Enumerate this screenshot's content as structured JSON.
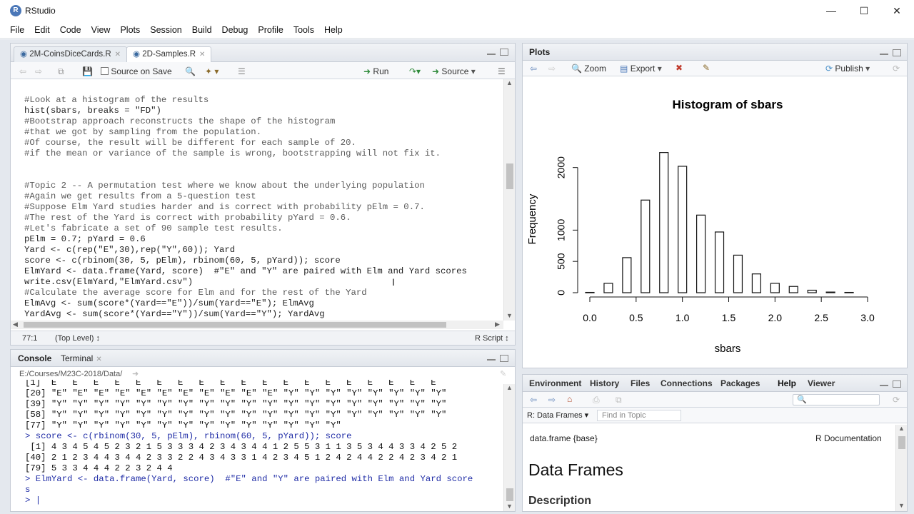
{
  "window": {
    "title": "RStudio",
    "logo": "R"
  },
  "menu": [
    "File",
    "Edit",
    "Code",
    "View",
    "Plots",
    "Session",
    "Build",
    "Debug",
    "Profile",
    "Tools",
    "Help"
  ],
  "editor": {
    "tabs": [
      "2M-CoinsDiceCards.R",
      "2D-Samples.R"
    ],
    "source_on_save": "Source on Save",
    "run": "Run",
    "source": "Source",
    "lines": [
      {
        "text": "#Look at a histogram of the results",
        "kind": "cmt"
      },
      {
        "text": "hist(sbars, breaks = \"FD\")",
        "kind": "code"
      },
      {
        "text": "#Bootstrap approach reconstructs the shape of the histogram",
        "kind": "cmt"
      },
      {
        "text": "#that we got by sampling from the population.",
        "kind": "cmt"
      },
      {
        "text": "#Of course, the result will be different for each sample of 20.",
        "kind": "cmt"
      },
      {
        "text": "#if the mean or variance of the sample is wrong, bootstrapping will not fix it.",
        "kind": "cmt"
      },
      {
        "text": "",
        "kind": "code"
      },
      {
        "text": "",
        "kind": "code"
      },
      {
        "text": "#Topic 2 -- A permutation test where we know about the underlying population",
        "kind": "cmt"
      },
      {
        "text": "#Again we get results from a 5-question test",
        "kind": "cmt"
      },
      {
        "text": "#Suppose Elm Yard studies harder and is correct with probability pElm = 0.7.",
        "kind": "cmt"
      },
      {
        "text": "#The rest of the Yard is correct with probability pYard = 0.6.",
        "kind": "cmt"
      },
      {
        "text": "#Let's fabricate a set of 90 sample test results.",
        "kind": "cmt"
      },
      {
        "text": "pElm = 0.7; pYard = 0.6",
        "kind": "code"
      },
      {
        "text": "Yard <- c(rep(\"E\",30),rep(\"Y\",60)); Yard",
        "kind": "code"
      },
      {
        "text": "score <- c(rbinom(30, 5, pElm), rbinom(60, 5, pYard)); score",
        "kind": "code"
      },
      {
        "text": "ElmYard <- data.frame(Yard, score)  #\"E\" and \"Y\" are paired with Elm and Yard scores",
        "kind": "code"
      },
      {
        "text": "write.csv(ElmYard,\"ElmYard.csv\")",
        "kind": "code"
      },
      {
        "text": "#Calculate the average score for Elm and for the rest of the Yard",
        "kind": "cmt"
      },
      {
        "text": "ElmAvg <- sum(score*(Yard==\"E\"))/sum(Yard==\"E\"); ElmAvg",
        "kind": "code"
      },
      {
        "text": "YardAvg <- sum(score*(Yard==\"Y\"))/sum(Yard==\"Y\"); YardAvg",
        "kind": "code"
      }
    ],
    "status_pos": "77:1",
    "status_scope": "(Top Level) ↕",
    "status_type": "R Script ↕"
  },
  "console": {
    "tabs": [
      "Console",
      "Terminal"
    ],
    "path": "E:/Courses/M23C-2018/Data/",
    "lines": [
      {
        "text": "[1]  E   E   E   E   E   E   E   E   E   E   E   E   E   E   E   E   E   E   E",
        "kind": "out"
      },
      {
        "text": "[20] \"E\" \"E\" \"E\" \"E\" \"E\" \"E\" \"E\" \"E\" \"E\" \"E\" \"E\" \"Y\" \"Y\" \"Y\" \"Y\" \"Y\" \"Y\" \"Y\" \"Y\"",
        "kind": "out"
      },
      {
        "text": "[39] \"Y\" \"Y\" \"Y\" \"Y\" \"Y\" \"Y\" \"Y\" \"Y\" \"Y\" \"Y\" \"Y\" \"Y\" \"Y\" \"Y\" \"Y\" \"Y\" \"Y\" \"Y\" \"Y\"",
        "kind": "out"
      },
      {
        "text": "[58] \"Y\" \"Y\" \"Y\" \"Y\" \"Y\" \"Y\" \"Y\" \"Y\" \"Y\" \"Y\" \"Y\" \"Y\" \"Y\" \"Y\" \"Y\" \"Y\" \"Y\" \"Y\" \"Y\"",
        "kind": "out"
      },
      {
        "text": "[77] \"Y\" \"Y\" \"Y\" \"Y\" \"Y\" \"Y\" \"Y\" \"Y\" \"Y\" \"Y\" \"Y\" \"Y\" \"Y\" \"Y\"",
        "kind": "out"
      },
      {
        "text": "> score <- c(rbinom(30, 5, pElm), rbinom(60, 5, pYard)); score",
        "kind": "cmd"
      },
      {
        "text": " [1] 4 3 4 5 4 5 2 3 2 1 5 3 3 3 4 2 3 4 3 4 4 1 2 5 5 3 1 1 3 5 3 4 4 3 3 4 2 5 2",
        "kind": "out"
      },
      {
        "text": "[40] 2 1 2 3 4 4 3 4 4 2 3 3 2 2 4 3 4 3 3 1 4 2 3 4 5 1 2 4 2 4 4 2 2 4 2 3 4 2 1",
        "kind": "out"
      },
      {
        "text": "[79] 5 3 3 4 4 4 2 2 3 2 4 4",
        "kind": "out"
      },
      {
        "text": "> ElmYard <- data.frame(Yard, score)  #\"E\" and \"Y\" are paired with Elm and Yard score",
        "kind": "cmd"
      },
      {
        "text": "s",
        "kind": "cmd"
      },
      {
        "text": "> |",
        "kind": "cmd"
      }
    ]
  },
  "plots": {
    "tab": "Plots",
    "zoom": "Zoom",
    "export": "Export",
    "publish": "Publish"
  },
  "chart_data": {
    "type": "bar",
    "title": "Histogram of sbars",
    "xlabel": "sbars",
    "ylabel": "Frequency",
    "x_ticks": [
      "0.0",
      "0.5",
      "1.0",
      "1.5",
      "2.0",
      "2.5",
      "3.0"
    ],
    "y_ticks": [
      "0",
      "500",
      "1000",
      "2000"
    ],
    "xlim": [
      0,
      3
    ],
    "ylim": [
      0,
      2350
    ],
    "bins": [
      {
        "x": 0.0,
        "value": 5
      },
      {
        "x": 0.2,
        "value": 150
      },
      {
        "x": 0.4,
        "value": 560
      },
      {
        "x": 0.6,
        "value": 1480
      },
      {
        "x": 0.8,
        "value": 2240
      },
      {
        "x": 1.0,
        "value": 2020
      },
      {
        "x": 1.2,
        "value": 1240
      },
      {
        "x": 1.4,
        "value": 970
      },
      {
        "x": 1.6,
        "value": 600
      },
      {
        "x": 1.8,
        "value": 300
      },
      {
        "x": 2.0,
        "value": 150
      },
      {
        "x": 2.2,
        "value": 100
      },
      {
        "x": 2.4,
        "value": 40
      },
      {
        "x": 2.6,
        "value": 10
      },
      {
        "x": 2.8,
        "value": 5
      }
    ],
    "bin_width": 0.1
  },
  "help": {
    "tabs": [
      "Environment",
      "History",
      "Files",
      "Connections",
      "Packages",
      "Help",
      "Viewer"
    ],
    "topic_label": "R: Data Frames ▾",
    "find_placeholder": "Find in Topic",
    "doc_left": "data.frame {base}",
    "doc_right": "R Documentation",
    "heading": "Data Frames",
    "section": "Description"
  },
  "colors": {
    "accent": "#4a77b8",
    "comment": "#5a5a5a",
    "console_cmd": "#1f2ca6",
    "pane_border": "#c6ccd5"
  }
}
